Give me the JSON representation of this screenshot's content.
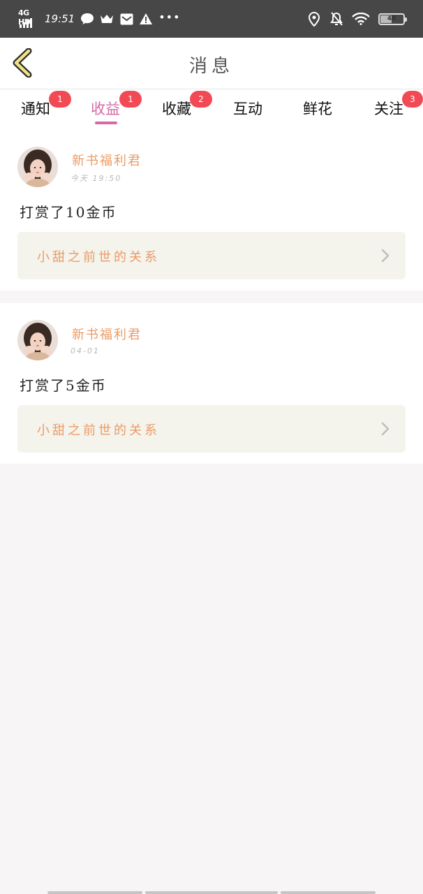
{
  "status_bar": {
    "network": "4G HD",
    "time": "19:51",
    "battery": "48",
    "battery_level": 0.48
  },
  "header": {
    "title": "消息"
  },
  "tabs": [
    {
      "label": "通知",
      "badge": "1",
      "active": false
    },
    {
      "label": "收益",
      "badge": "1",
      "active": true
    },
    {
      "label": "收藏",
      "badge": "2",
      "active": false
    },
    {
      "label": "互动",
      "badge": "",
      "active": false
    },
    {
      "label": "鲜花",
      "badge": "",
      "active": false
    },
    {
      "label": "关注",
      "badge": "3",
      "active": false
    }
  ],
  "messages": [
    {
      "username": "新书福利君",
      "time": "今天 19:50",
      "text": "打赏了10金币",
      "book_title": "小甜之前世的关系"
    },
    {
      "username": "新书福利君",
      "time": "04-01",
      "text": "打赏了5金币",
      "book_title": "小甜之前世的关系"
    }
  ],
  "colors": {
    "accent_pink": "#d66aa6",
    "badge_red": "#f24a55",
    "username_orange": "#ec9b66",
    "back_yellow": "#f0e287"
  },
  "icons": {
    "back": "chevron-left-icon",
    "link_arrow": "chevron-right-icon"
  }
}
